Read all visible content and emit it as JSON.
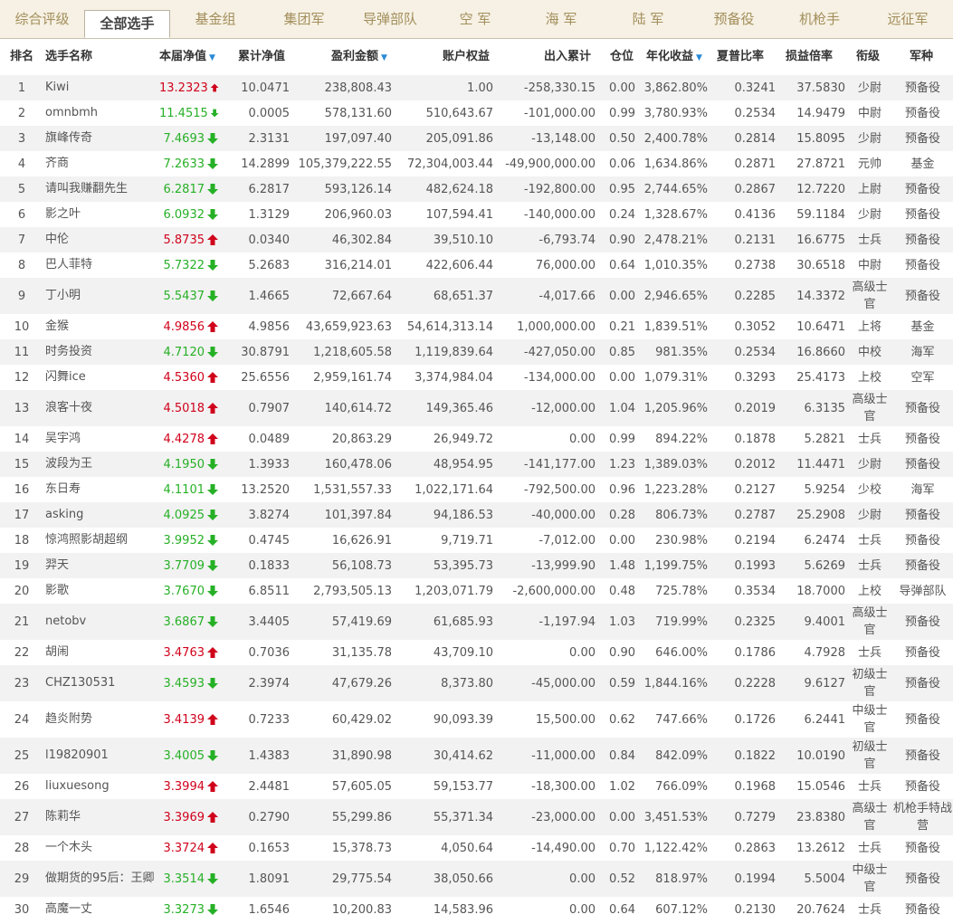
{
  "tabs": [
    "综合评级",
    "全部选手",
    "基金组",
    "集团军",
    "导弹部队",
    "空 军",
    "海 军",
    "陆 军",
    "预备役",
    "机枪手",
    "远征军"
  ],
  "active_tab": 1,
  "headers": {
    "rank": "排名",
    "name": "选手名称",
    "nav": "本届净值",
    "cum": "累计净值",
    "profit": "盈利金额",
    "account": "账户权益",
    "inout": "出入累计",
    "position": "仓位",
    "annual": "年化收益",
    "sharpe": "夏普比率",
    "ratio": "损益倍率",
    "title": "衔级",
    "arm": "军种",
    "sort_marker": "▼"
  },
  "rows": [
    {
      "rank": "1",
      "name": "Kiwi",
      "nav": "13.2323",
      "dir": "up",
      "cum": "10.0471",
      "profit": "238,808.43",
      "account": "1.00",
      "inout": "-258,330.15",
      "position": "0.00",
      "annual": "3,862.80%",
      "sharpe": "0.3241",
      "ratio": "37.5830",
      "title": "少尉",
      "arm": "预备役"
    },
    {
      "rank": "2",
      "name": "omnbmh",
      "nav": "11.4515",
      "dir": "down",
      "cum": "0.0005",
      "profit": "578,131.60",
      "account": "510,643.67",
      "inout": "-101,000.00",
      "position": "0.99",
      "annual": "3,780.93%",
      "sharpe": "0.2534",
      "ratio": "14.9479",
      "title": "中尉",
      "arm": "预备役"
    },
    {
      "rank": "3",
      "name": "旗峰传奇",
      "nav": "7.4693",
      "dir": "down",
      "cum": "2.3131",
      "profit": "197,097.40",
      "account": "205,091.86",
      "inout": "-13,148.00",
      "position": "0.50",
      "annual": "2,400.78%",
      "sharpe": "0.2814",
      "ratio": "15.8095",
      "title": "少尉",
      "arm": "预备役"
    },
    {
      "rank": "4",
      "name": "齐商",
      "nav": "7.2633",
      "dir": "down",
      "cum": "14.2899",
      "profit": "105,379,222.55",
      "account": "72,304,003.44",
      "inout": "-49,900,000.00",
      "position": "0.06",
      "annual": "1,634.86%",
      "sharpe": "0.2871",
      "ratio": "27.8721",
      "title": "元帅",
      "arm": "基金"
    },
    {
      "rank": "5",
      "name": "请叫我赚翻先生",
      "nav": "6.2817",
      "dir": "down",
      "cum": "6.2817",
      "profit": "593,126.14",
      "account": "482,624.18",
      "inout": "-192,800.00",
      "position": "0.95",
      "annual": "2,744.65%",
      "sharpe": "0.2867",
      "ratio": "12.7220",
      "title": "上尉",
      "arm": "预备役"
    },
    {
      "rank": "6",
      "name": "影之叶",
      "nav": "6.0932",
      "dir": "down",
      "cum": "1.3129",
      "profit": "206,960.03",
      "account": "107,594.41",
      "inout": "-140,000.00",
      "position": "0.24",
      "annual": "1,328.67%",
      "sharpe": "0.4136",
      "ratio": "59.1184",
      "title": "少尉",
      "arm": "预备役"
    },
    {
      "rank": "7",
      "name": "中伦",
      "nav": "5.8735",
      "dir": "up",
      "cum": "0.0340",
      "profit": "46,302.84",
      "account": "39,510.10",
      "inout": "-6,793.74",
      "position": "0.90",
      "annual": "2,478.21%",
      "sharpe": "0.2131",
      "ratio": "16.6775",
      "title": "士兵",
      "arm": "预备役"
    },
    {
      "rank": "8",
      "name": "巴人菲特",
      "nav": "5.7322",
      "dir": "down",
      "cum": "5.2683",
      "profit": "316,214.01",
      "account": "422,606.44",
      "inout": "76,000.00",
      "position": "0.64",
      "annual": "1,010.35%",
      "sharpe": "0.2738",
      "ratio": "30.6518",
      "title": "中尉",
      "arm": "预备役"
    },
    {
      "rank": "9",
      "name": "丁小明",
      "nav": "5.5437",
      "dir": "down",
      "cum": "1.4665",
      "profit": "72,667.64",
      "account": "68,651.37",
      "inout": "-4,017.66",
      "position": "0.00",
      "annual": "2,946.65%",
      "sharpe": "0.2285",
      "ratio": "14.3372",
      "title": "高级士官",
      "arm": "预备役",
      "tall": true
    },
    {
      "rank": "10",
      "name": "金猴",
      "nav": "4.9856",
      "dir": "up",
      "cum": "4.9856",
      "profit": "43,659,923.63",
      "account": "54,614,313.14",
      "inout": "1,000,000.00",
      "position": "0.21",
      "annual": "1,839.51%",
      "sharpe": "0.3052",
      "ratio": "10.6471",
      "title": "上将",
      "arm": "基金"
    },
    {
      "rank": "11",
      "name": "时务投资",
      "nav": "4.7120",
      "dir": "down",
      "cum": "30.8791",
      "profit": "1,218,605.58",
      "account": "1,119,839.64",
      "inout": "-427,050.00",
      "position": "0.85",
      "annual": "981.35%",
      "sharpe": "0.2534",
      "ratio": "16.8660",
      "title": "中校",
      "arm": "海军"
    },
    {
      "rank": "12",
      "name": "闪舞ice",
      "nav": "4.5360",
      "dir": "up",
      "cum": "25.6556",
      "profit": "2,959,161.74",
      "account": "3,374,984.04",
      "inout": "-134,000.00",
      "position": "0.00",
      "annual": "1,079.31%",
      "sharpe": "0.3293",
      "ratio": "25.4173",
      "title": "上校",
      "arm": "空军"
    },
    {
      "rank": "13",
      "name": "浪客十夜",
      "nav": "4.5018",
      "dir": "up",
      "cum": "0.7907",
      "profit": "140,614.72",
      "account": "149,365.46",
      "inout": "-12,000.00",
      "position": "1.04",
      "annual": "1,205.96%",
      "sharpe": "0.2019",
      "ratio": "6.3135",
      "title": "高级士官",
      "arm": "预备役",
      "tall": true
    },
    {
      "rank": "14",
      "name": "吴宇鸿",
      "nav": "4.4278",
      "dir": "up",
      "cum": "0.0489",
      "profit": "20,863.29",
      "account": "26,949.72",
      "inout": "0.00",
      "position": "0.99",
      "annual": "894.22%",
      "sharpe": "0.1878",
      "ratio": "5.2821",
      "title": "士兵",
      "arm": "预备役"
    },
    {
      "rank": "15",
      "name": "波段为王",
      "nav": "4.1950",
      "dir": "down",
      "cum": "1.3933",
      "profit": "160,478.06",
      "account": "48,954.95",
      "inout": "-141,177.00",
      "position": "1.23",
      "annual": "1,389.03%",
      "sharpe": "0.2012",
      "ratio": "11.4471",
      "title": "少尉",
      "arm": "预备役"
    },
    {
      "rank": "16",
      "name": "东日寿",
      "nav": "4.1101",
      "dir": "down",
      "cum": "13.2520",
      "profit": "1,531,557.33",
      "account": "1,022,171.64",
      "inout": "-792,500.00",
      "position": "0.96",
      "annual": "1,223.28%",
      "sharpe": "0.2127",
      "ratio": "5.9254",
      "title": "少校",
      "arm": "海军"
    },
    {
      "rank": "17",
      "name": "asking",
      "nav": "4.0925",
      "dir": "down",
      "cum": "3.8274",
      "profit": "101,397.84",
      "account": "94,186.53",
      "inout": "-40,000.00",
      "position": "0.28",
      "annual": "806.73%",
      "sharpe": "0.2787",
      "ratio": "25.2908",
      "title": "少尉",
      "arm": "预备役"
    },
    {
      "rank": "18",
      "name": "惊鸿照影胡超纲",
      "nav": "3.9952",
      "dir": "down",
      "cum": "0.4745",
      "profit": "16,626.91",
      "account": "9,719.71",
      "inout": "-7,012.00",
      "position": "0.00",
      "annual": "230.98%",
      "sharpe": "0.2194",
      "ratio": "6.2474",
      "title": "士兵",
      "arm": "预备役"
    },
    {
      "rank": "19",
      "name": "羿天",
      "nav": "3.7709",
      "dir": "down",
      "cum": "0.1833",
      "profit": "56,108.73",
      "account": "53,395.73",
      "inout": "-13,999.90",
      "position": "1.48",
      "annual": "1,199.75%",
      "sharpe": "0.1993",
      "ratio": "5.6269",
      "title": "士兵",
      "arm": "预备役"
    },
    {
      "rank": "20",
      "name": "影歌",
      "nav": "3.7670",
      "dir": "down",
      "cum": "6.8511",
      "profit": "2,793,505.13",
      "account": "1,203,071.79",
      "inout": "-2,600,000.00",
      "position": "0.48",
      "annual": "725.78%",
      "sharpe": "0.3534",
      "ratio": "18.7000",
      "title": "上校",
      "arm": "导弹部队"
    },
    {
      "rank": "21",
      "name": "netobv",
      "nav": "3.6867",
      "dir": "down",
      "cum": "3.4405",
      "profit": "57,419.69",
      "account": "61,685.93",
      "inout": "-1,197.94",
      "position": "1.03",
      "annual": "719.99%",
      "sharpe": "0.2325",
      "ratio": "9.4001",
      "title": "高级士官",
      "arm": "预备役",
      "tall": true
    },
    {
      "rank": "22",
      "name": "胡闹",
      "nav": "3.4763",
      "dir": "up",
      "cum": "0.7036",
      "profit": "31,135.78",
      "account": "43,709.10",
      "inout": "0.00",
      "position": "0.90",
      "annual": "646.00%",
      "sharpe": "0.1786",
      "ratio": "4.7928",
      "title": "士兵",
      "arm": "预备役"
    },
    {
      "rank": "23",
      "name": "CHZ130531",
      "nav": "3.4593",
      "dir": "down",
      "cum": "2.3974",
      "profit": "47,679.26",
      "account": "8,373.80",
      "inout": "-45,000.00",
      "position": "0.59",
      "annual": "1,844.16%",
      "sharpe": "0.2228",
      "ratio": "9.6127",
      "title": "初级士官",
      "arm": "预备役",
      "tall": true
    },
    {
      "rank": "24",
      "name": "趋炎附势",
      "nav": "3.4139",
      "dir": "up",
      "cum": "0.7233",
      "profit": "60,429.02",
      "account": "90,093.39",
      "inout": "15,500.00",
      "position": "0.62",
      "annual": "747.66%",
      "sharpe": "0.1726",
      "ratio": "6.2441",
      "title": "中级士官",
      "arm": "预备役",
      "tall": true
    },
    {
      "rank": "25",
      "name": "l19820901",
      "nav": "3.4005",
      "dir": "down",
      "cum": "1.4383",
      "profit": "31,890.98",
      "account": "30,414.62",
      "inout": "-11,000.00",
      "position": "0.84",
      "annual": "842.09%",
      "sharpe": "0.1822",
      "ratio": "10.0190",
      "title": "初级士官",
      "arm": "预备役",
      "tall": true
    },
    {
      "rank": "26",
      "name": "liuxuesong",
      "nav": "3.3994",
      "dir": "up",
      "cum": "2.4481",
      "profit": "57,605.05",
      "account": "59,153.77",
      "inout": "-18,300.00",
      "position": "1.02",
      "annual": "766.09%",
      "sharpe": "0.1968",
      "ratio": "15.0546",
      "title": "士兵",
      "arm": "预备役"
    },
    {
      "rank": "27",
      "name": "陈莉华",
      "nav": "3.3969",
      "dir": "up",
      "cum": "0.2790",
      "profit": "55,299.86",
      "account": "55,371.34",
      "inout": "-23,000.00",
      "position": "0.00",
      "annual": "3,451.53%",
      "sharpe": "0.7279",
      "ratio": "23.8380",
      "title": "高级士官",
      "arm": "机枪手特战营",
      "tall": true
    },
    {
      "rank": "28",
      "name": "一个木头",
      "nav": "3.3724",
      "dir": "up",
      "cum": "0.1653",
      "profit": "15,378.73",
      "account": "4,050.64",
      "inout": "-14,490.00",
      "position": "0.70",
      "annual": "1,122.42%",
      "sharpe": "0.2863",
      "ratio": "13.2612",
      "title": "士兵",
      "arm": "预备役"
    },
    {
      "rank": "29",
      "name": "做期货的95后：王卿",
      "nav": "3.3514",
      "dir": "down",
      "cum": "1.8091",
      "profit": "29,775.54",
      "account": "38,050.66",
      "inout": "0.00",
      "position": "0.52",
      "annual": "818.97%",
      "sharpe": "0.1994",
      "ratio": "5.5004",
      "title": "中级士官",
      "arm": "预备役",
      "tall": true
    },
    {
      "rank": "30",
      "name": "高魔一丈",
      "nav": "3.3273",
      "dir": "down",
      "cum": "1.6546",
      "profit": "10,200.83",
      "account": "14,583.96",
      "inout": "0.00",
      "position": "0.64",
      "annual": "607.12%",
      "sharpe": "0.2130",
      "ratio": "20.7624",
      "title": "士兵",
      "arm": "预备役"
    }
  ],
  "colors": {
    "up": "#d0021b",
    "down": "#26b026",
    "sort": "#2a8bd6",
    "tab_text": "#a38e5c"
  }
}
